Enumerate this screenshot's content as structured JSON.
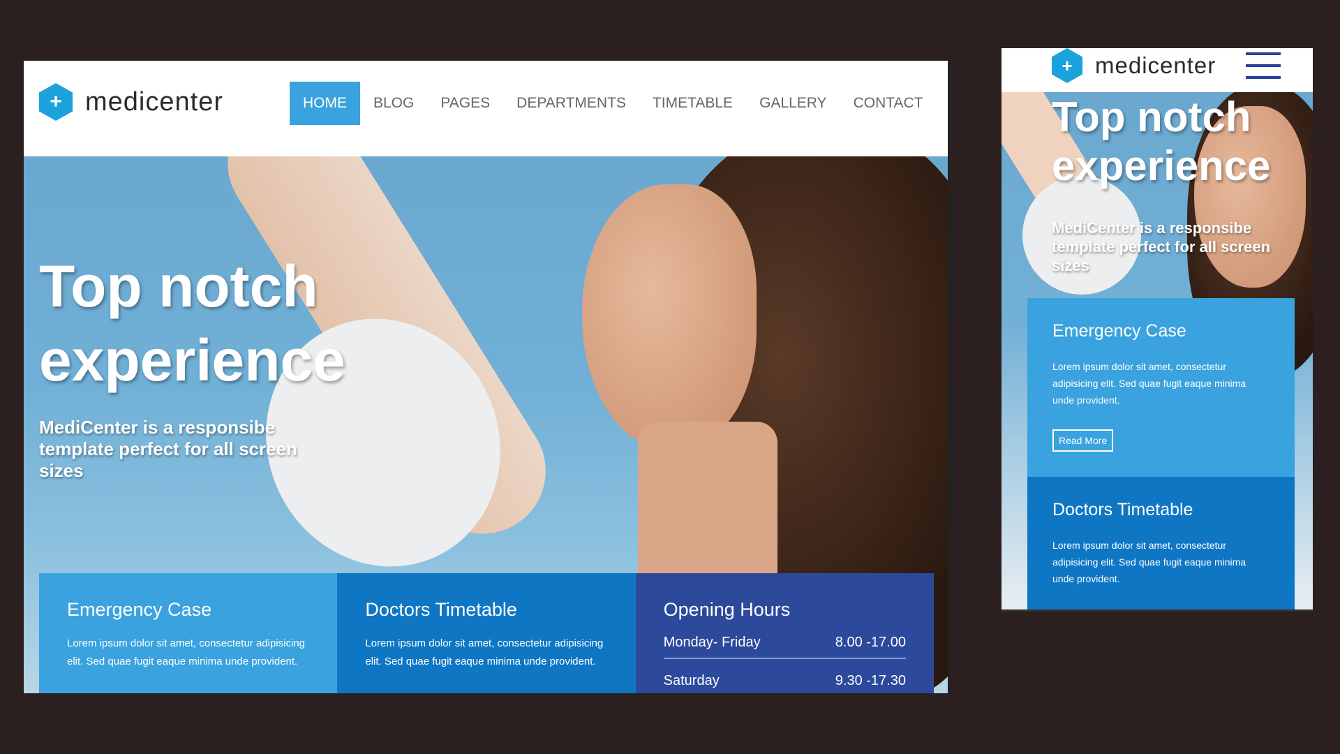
{
  "brand": {
    "logo_text": "medicenter",
    "logo_glyph": "+",
    "accent": "#3aa2de"
  },
  "nav": {
    "items": [
      {
        "label": "HOME",
        "active": true
      },
      {
        "label": "BLOG"
      },
      {
        "label": "PAGES"
      },
      {
        "label": "DEPARTMENTS"
      },
      {
        "label": "TIMETABLE"
      },
      {
        "label": "GALLERY"
      },
      {
        "label": "CONTACT"
      }
    ]
  },
  "hero": {
    "title_line1": "Top notch",
    "title_line2": "experience",
    "subtitle": "MediCenter is a responsibe template perfect for all screen sizes"
  },
  "boxes": {
    "emergency": {
      "title": "Emergency Case",
      "text": "Lorem ipsum dolor sit amet, consectetur adipisicing elit. Sed quae fugit eaque minima unde provident.",
      "button": "Read More",
      "color": "#3aa2de"
    },
    "timetable": {
      "title": "Doctors Timetable",
      "text": "Lorem ipsum dolor sit amet, consectetur adipisicing elit. Sed quae fugit eaque minima unde provident.",
      "color": "#0f76c4"
    },
    "hours": {
      "title": "Opening Hours",
      "color": "#2c499b",
      "rows": [
        {
          "day": "Monday- Friday",
          "time": "8.00 -17.00"
        },
        {
          "day": "Saturday",
          "time": "9.30 -17.30"
        }
      ]
    }
  },
  "icons": {
    "logo": "medical-cross-hex-icon",
    "menu": "hamburger-menu-icon"
  }
}
